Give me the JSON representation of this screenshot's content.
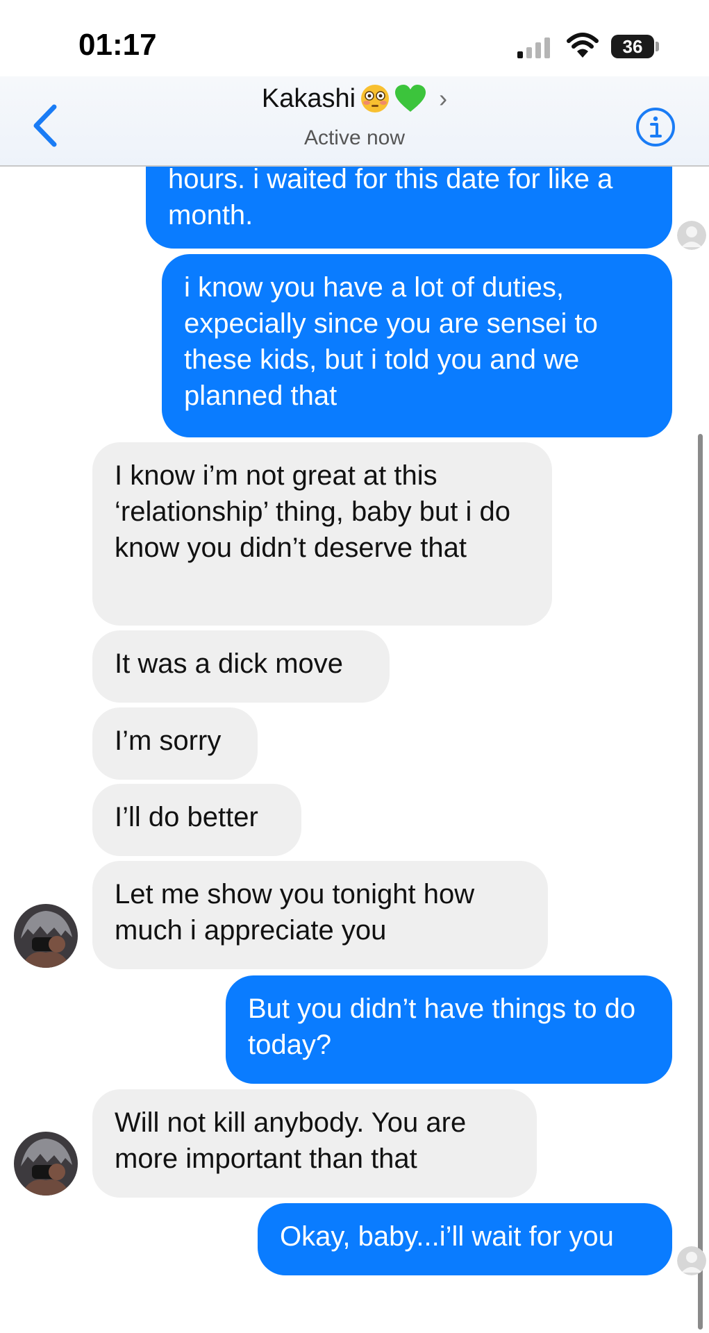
{
  "status_bar": {
    "time": "01:17",
    "battery": "36"
  },
  "header": {
    "contact_name": "Kakashi",
    "emojis": [
      "flushed-face",
      "green-heart"
    ],
    "subtitle": "Active now"
  },
  "colors": {
    "outgoing": "#0a7cff",
    "incoming": "#efefef",
    "accent": "#1a7cf5"
  },
  "messages": [
    {
      "sender": "me",
      "text": "hours. i waited for this date for like a month."
    },
    {
      "sender": "me",
      "text": "i know you have a lot of duties, expecially since you are sensei to these kids, but i told you and we planned that"
    },
    {
      "sender": "them",
      "text": "I know i’m not great at this ‘relationship’ thing, baby but i do know you didn’t deserve that"
    },
    {
      "sender": "them",
      "text": "It was a dick move"
    },
    {
      "sender": "them",
      "text": "I’m sorry"
    },
    {
      "sender": "them",
      "text": "I’ll do better"
    },
    {
      "sender": "them",
      "text": "Let me show you tonight how much i appreciate you"
    },
    {
      "sender": "me",
      "text": "But you didn’t have things to do today?"
    },
    {
      "sender": "them",
      "text": "Will not kill anybody. You are more important than that"
    },
    {
      "sender": "me",
      "text": "Okay, baby...i’ll wait for you"
    }
  ]
}
